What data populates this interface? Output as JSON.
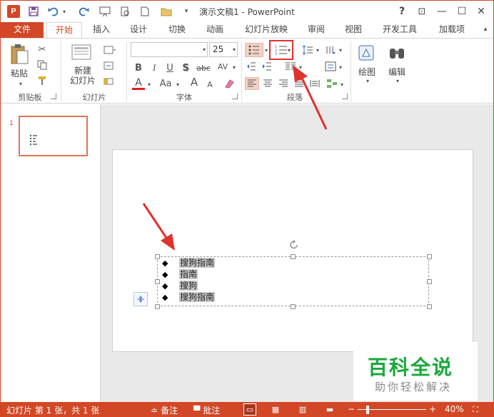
{
  "window": {
    "title": "演示文稿1 - PowerPoint",
    "app_badge": "P"
  },
  "quick_access": {
    "save_icon": "save-icon",
    "undo_icon": "undo-icon",
    "redo_icon": "redo-icon",
    "customize_icon": "chevron-down-icon"
  },
  "window_controls": {
    "help": "?",
    "restore_ribbon": "⊡",
    "minimize": "—",
    "maximize": "☐",
    "close": "✕"
  },
  "tabs": [
    {
      "label": "文件"
    },
    {
      "label": "开始"
    },
    {
      "label": "插入"
    },
    {
      "label": "设计"
    },
    {
      "label": "切换"
    },
    {
      "label": "动画"
    },
    {
      "label": "幻灯片放映"
    },
    {
      "label": "审阅"
    },
    {
      "label": "视图"
    },
    {
      "label": "开发工具"
    },
    {
      "label": "加载项"
    }
  ],
  "ribbon": {
    "clipboard": {
      "label": "剪贴板",
      "paste": "粘贴"
    },
    "slides": {
      "label": "幻灯片",
      "new_slide_line1": "新建",
      "new_slide_line2": "幻灯片"
    },
    "font": {
      "label": "字体",
      "font_name": "",
      "font_size": "25",
      "bold": "B",
      "italic": "I",
      "underline": "U",
      "shadow": "S",
      "strike": "abc",
      "spacing": "AV",
      "font_color": "A",
      "change_case": "Aa",
      "grow": "A",
      "shrink": "A"
    },
    "paragraph": {
      "label": "段落"
    },
    "drawing": {
      "label": "绘图"
    },
    "editing": {
      "label": "编辑"
    }
  },
  "thumbnails": [
    {
      "number": "1"
    }
  ],
  "slide": {
    "bullets": [
      {
        "text": "搜狗指南"
      },
      {
        "text": "指南"
      },
      {
        "text": "搜狗"
      },
      {
        "text": "搜狗指南"
      }
    ]
  },
  "watermark": {
    "main": "百科全说",
    "sub": "助你轻松解决"
  },
  "statusbar": {
    "slide_info": "幻灯片 第 1 张，共 1 张",
    "notes": "备注",
    "comments": "批注",
    "zoom": "40%"
  },
  "colors": {
    "accent": "#d24726",
    "highlight": "#e0322e",
    "watermark_green": "#1aa83a"
  }
}
